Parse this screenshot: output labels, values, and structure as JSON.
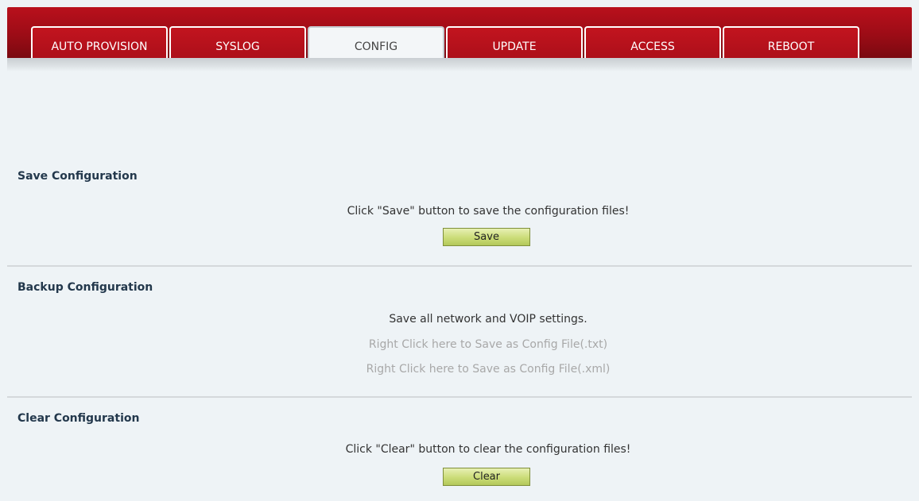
{
  "tabs": [
    {
      "label": "AUTO PROVISION",
      "active": false
    },
    {
      "label": "SYSLOG",
      "active": false
    },
    {
      "label": "CONFIG",
      "active": true
    },
    {
      "label": "UPDATE",
      "active": false
    },
    {
      "label": "ACCESS",
      "active": false
    },
    {
      "label": "REBOOT",
      "active": false
    }
  ],
  "save_section": {
    "title": "Save Configuration",
    "description": "Click \"Save\" button to save the configuration files!",
    "button_label": "Save"
  },
  "backup_section": {
    "title": "Backup Configuration",
    "description": "Save all network and VOIP settings.",
    "link_txt": "Right Click here to Save as Config File(.txt)",
    "link_xml": "Right Click here to Save as Config File(.xml)"
  },
  "clear_section": {
    "title": "Clear Configuration",
    "description": "Click \"Clear\" button to clear the configuration files!",
    "button_label": "Clear"
  },
  "colors": {
    "tab_red": "#a80e18",
    "active_tab": "#f3f6f8",
    "background": "#eef3f6",
    "button_green": "#cbdc78",
    "section_title": "#23384c",
    "link_gray": "#a8a8a8"
  }
}
